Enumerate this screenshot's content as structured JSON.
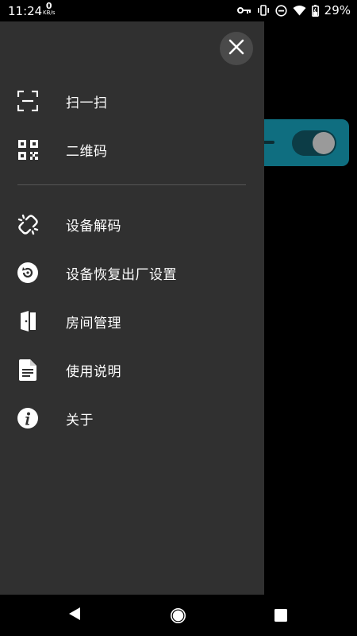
{
  "status_bar": {
    "time": "11:24",
    "net_speed_value": "0",
    "net_speed_unit": "KB/s",
    "battery": "29%",
    "icons": [
      "key-icon",
      "vibrate-icon",
      "dnd-icon",
      "wifi-icon",
      "battery-icon"
    ]
  },
  "drawer": {
    "close_icon": "close-icon",
    "items": [
      {
        "label": "扫一扫",
        "icon": "scan-icon"
      },
      {
        "label": "二维码",
        "icon": "qrcode-icon"
      },
      {
        "label": "设备解码",
        "icon": "unlink-icon"
      },
      {
        "label": "设备恢复出厂设置",
        "icon": "restore-icon"
      },
      {
        "label": "房间管理",
        "icon": "door-icon"
      },
      {
        "label": "使用说明",
        "icon": "document-icon"
      },
      {
        "label": "关于",
        "icon": "info-icon"
      }
    ]
  },
  "background": {
    "toggle_state": "on",
    "accent_color": "#0f6e80"
  },
  "nav_bar": {
    "icons": [
      "back-icon",
      "home-icon",
      "recents-icon"
    ]
  }
}
